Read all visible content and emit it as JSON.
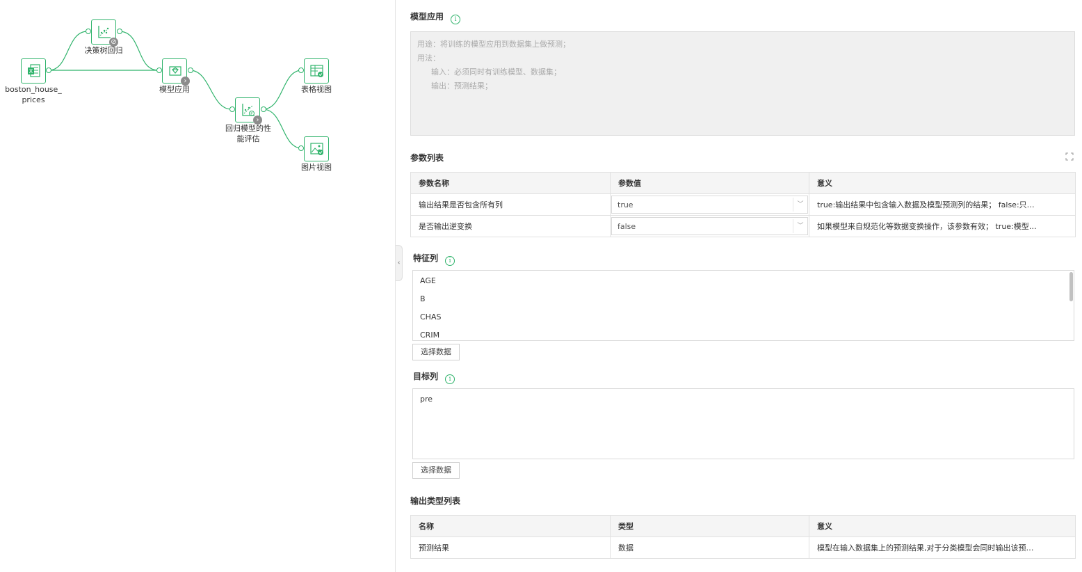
{
  "colors": {
    "accent": "#2fb36b",
    "badge": "#8c8c8c"
  },
  "canvas": {
    "nodes": [
      {
        "id": "boston",
        "label": "boston_house_\nprices",
        "icon": "excel-icon"
      },
      {
        "id": "dtree",
        "label": "决策树回归",
        "icon": "regression-icon",
        "badge": "disabled"
      },
      {
        "id": "apply",
        "label": "模型应用",
        "icon": "model-apply-icon",
        "badge": "run"
      },
      {
        "id": "eval",
        "label": "回归模型的性\n能评估",
        "icon": "regression-eval-icon",
        "badge": "run"
      },
      {
        "id": "table_view",
        "label": "表格视图",
        "icon": "table-view-icon"
      },
      {
        "id": "image_view",
        "label": "图片视图",
        "icon": "image-view-icon"
      }
    ]
  },
  "panel": {
    "title": "模型应用",
    "description": {
      "usage": "用途：将训练的模型应用到数据集上做预测；",
      "method": "用法：",
      "input": "输入：必须同时有训练模型、数据集；",
      "output": "输出：预测结果；"
    },
    "params": {
      "title": "参数列表",
      "headers": [
        "参数名称",
        "参数值",
        "意义"
      ],
      "rows": [
        {
          "name": "输出结果是否包含所有列",
          "value": "true",
          "meaning": "true:输出结果中包含输入数据及模型预测列的结果； false:只…"
        },
        {
          "name": "是否输出逆变换",
          "value": "false",
          "meaning": "如果模型来自规范化等数据变换操作，该参数有效； true:模型…"
        }
      ]
    },
    "features": {
      "title": "特征列",
      "items": [
        "AGE",
        "B",
        "CHAS",
        "CRIM"
      ],
      "button": "选择数据"
    },
    "target": {
      "title": "目标列",
      "items": [
        "pre"
      ],
      "button": "选择数据"
    },
    "outputs": {
      "title": "输出类型列表",
      "headers": [
        "名称",
        "类型",
        "意义"
      ],
      "rows": [
        {
          "name": "预测结果",
          "type": "数据",
          "meaning": "模型在输入数据集上的预测结果,对于分类模型会同时输出该预…"
        }
      ]
    }
  }
}
